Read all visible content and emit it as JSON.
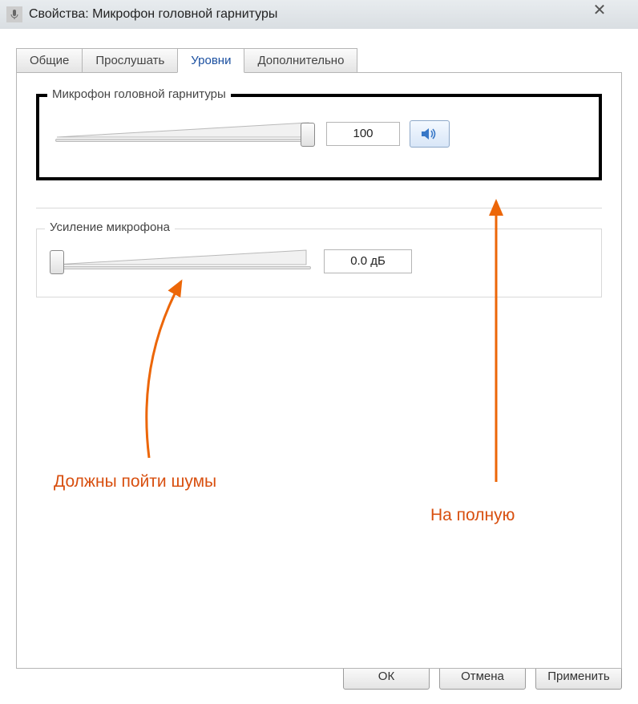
{
  "window": {
    "title": "Свойства: Микрофон головной гарнитуры"
  },
  "tabs": {
    "general": "Общие",
    "listen": "Прослушать",
    "levels": "Уровни",
    "advanced": "Дополнительно",
    "active": "levels"
  },
  "level_group": {
    "legend": "Микрофон головной гарнитуры",
    "value": "100",
    "slider_percent": 100
  },
  "gain_group": {
    "legend": "Усиление микрофона",
    "value": "0.0 дБ",
    "slider_percent": 0
  },
  "annotations": {
    "noise": "Должны пойти шумы",
    "full": "На полную"
  },
  "buttons": {
    "ok": "ОК",
    "cancel": "Отмена",
    "apply": "Применить"
  }
}
